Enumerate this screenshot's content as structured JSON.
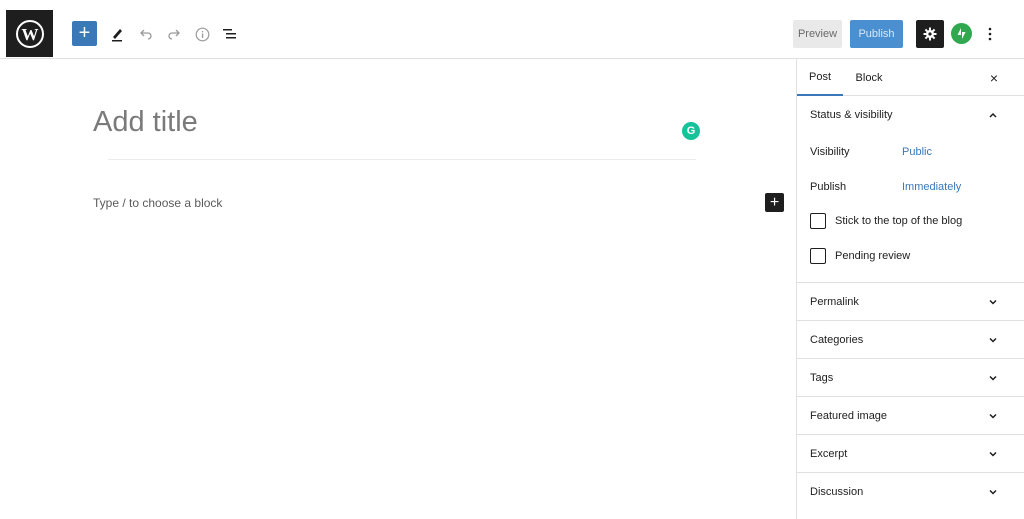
{
  "toolbar": {
    "logo_icon": "wordpress-logo-icon",
    "add_block_icon": "plus-icon",
    "tools_icon": "pencil-icon",
    "undo_icon": "undo-icon",
    "redo_icon": "redo-icon",
    "details_icon": "info-icon",
    "list_view_icon": "list-view-icon",
    "preview_label": "Preview",
    "publish_label": "Publish",
    "settings_icon": "gear-icon",
    "jetpack_icon": "jetpack-icon",
    "more_icon": "more-vertical-icon"
  },
  "editor": {
    "title_placeholder": "Add title",
    "block_placeholder": "Type / to choose a block",
    "grammarly_icon": "grammarly-icon",
    "inserter_label": "+"
  },
  "sidebar": {
    "tabs": [
      {
        "label": "Post",
        "active": true
      },
      {
        "label": "Block",
        "active": false
      }
    ],
    "close_label": "×",
    "status": {
      "title": "Status & visibility",
      "visibility_label": "Visibility",
      "visibility_value": "Public",
      "publish_label": "Publish",
      "publish_value": "Immediately",
      "sticky_label": "Stick to the top of the blog",
      "pending_label": "Pending review"
    },
    "panels": [
      {
        "title": "Permalink"
      },
      {
        "title": "Categories"
      },
      {
        "title": "Tags"
      },
      {
        "title": "Featured image"
      },
      {
        "title": "Excerpt"
      },
      {
        "title": "Discussion"
      }
    ]
  },
  "colors": {
    "accent": "#3a78b8",
    "publish_bg": "#4a8fcf",
    "jetpack": "#2fa84f",
    "grammarly": "#15c39a"
  }
}
